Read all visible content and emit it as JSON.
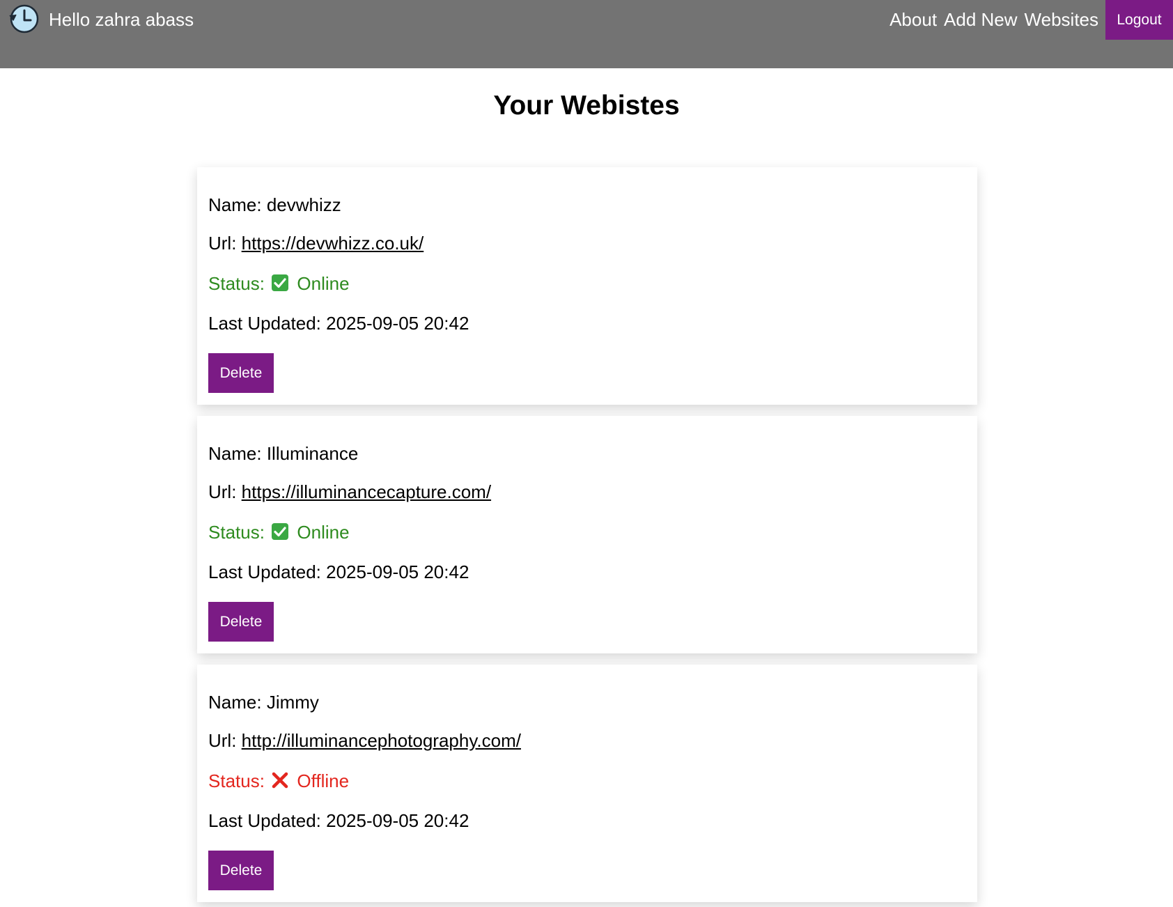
{
  "header": {
    "logo_icon": "clock-history-icon",
    "greeting": "Hello zahra abass",
    "links": [
      "About",
      "Add New",
      "Websites"
    ],
    "logout_label": "Logout"
  },
  "page_title": "Your Webistes",
  "websites": [
    {
      "name_label": "Name:",
      "name": "devwhizz",
      "url_label": "Url:",
      "url": "https://devwhizz.co.uk/",
      "status_label": "Status:",
      "status": "Online",
      "status_icon": "check-box-icon",
      "last_updated_label": "Last Updated:",
      "last_updated": "2025-09-05 20:42",
      "delete_label": "Delete"
    },
    {
      "name_label": "Name:",
      "name": "Illuminance",
      "url_label": "Url:",
      "url": "https://illuminancecapture.com/",
      "status_label": "Status:",
      "status": "Online",
      "status_icon": "check-box-icon",
      "last_updated_label": "Last Updated:",
      "last_updated": "2025-09-05 20:42",
      "delete_label": "Delete"
    },
    {
      "name_label": "Name:",
      "name": "Jimmy",
      "url_label": "Url:",
      "url": "http://illuminancephotography.com/",
      "status_label": "Status:",
      "status": "Offline",
      "status_icon": "cross-mark-icon",
      "last_updated_label": "Last Updated:",
      "last_updated": "2025-09-05 20:42",
      "delete_label": "Delete"
    }
  ],
  "colors": {
    "navbar": "#737373",
    "accent": "#7b1b85",
    "online": "#2e8b1f",
    "offline": "#e3261e"
  }
}
